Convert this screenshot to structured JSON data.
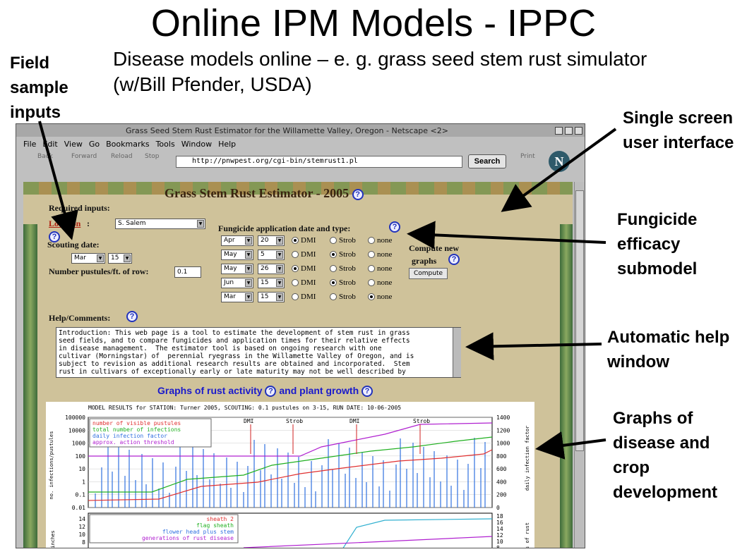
{
  "slide": {
    "title": "Online IPM Models - IPPC",
    "subtitle": "Disease models online – e. g. grass seed stem rust simulator (w/Bill Pfender, USDA)"
  },
  "callouts": {
    "field_sample": "Field sample inputs",
    "single_screen": "Single screen user interface",
    "fungicide": "Fungicide efficacy submodel",
    "help": "Automatic help window",
    "graphs": "Graphs of disease and crop development"
  },
  "browser": {
    "window_title": "Grass Seed Stem Rust Estimator for the Willamette Valley, Oregon - Netscape <2>",
    "menu": [
      "File",
      "Edit",
      "View",
      "Go",
      "Bookmarks",
      "Tools",
      "Window",
      "Help"
    ],
    "toolbar": {
      "back": "Back",
      "forward": "Forward",
      "reload": "Reload",
      "stop": "Stop",
      "url": "http://pnwpest.org/cgi-bin/stemrust1.pl",
      "search": "Search",
      "print": "Print"
    }
  },
  "app": {
    "title": "Grass Stem Rust Estimator - 2005",
    "required_inputs": "Required inputs:",
    "location_label": "Location",
    "location_value": "S. Salem",
    "scouting_label": "Scouting date:",
    "scouting_month": "Mar",
    "scouting_day": "15",
    "pustules_label": "Number pustules/ft. of row:",
    "pustules_value": "0.1",
    "fungicide_header": "Fungicide application date and type:",
    "applications": [
      {
        "month": "Apr",
        "day": "20",
        "type": "DMI"
      },
      {
        "month": "May",
        "day": "5",
        "type": "Strob"
      },
      {
        "month": "May",
        "day": "26",
        "type": "DMI"
      },
      {
        "month": "Jun",
        "day": "15",
        "type": "Strob"
      },
      {
        "month": "Mar",
        "day": "15",
        "type": "none"
      }
    ],
    "type_options": [
      "DMI",
      "Strob",
      "none"
    ],
    "compute_label_1": "Compute new",
    "compute_label_2": "graphs",
    "compute_button": "Compute",
    "help_label": "Help/Comments:",
    "help_text": "Introduction: This web page is a tool to estimate the development of stem rust in grass\nseed fields, and to compare fungicides and application times for their relative effects\nin disease management.  The estimator tool is based on ongoing research with one\ncultivar (Morningstar) of  perennial ryegrass in the Willamette Valley of Oregon, and is\nsubject to revision as additional research results are obtained and incorporated.  Stem\nrust in cultivars of exceptionally early or late maturity may not be well described by",
    "graphs_header_1": "Graphs of rust activity",
    "graphs_header_2": "and plant growth"
  },
  "chart_data": [
    {
      "type": "line",
      "title": "MODEL RESULTS for STATION: Turner 2005, SCOUTING: 0.1 pustules on 3-15, RUN DATE: 10-06-2005",
      "ylabel": "no. infections/pustules",
      "y2label": "daily infection factor",
      "y_ticks": [
        "100000",
        "10000",
        "1000",
        "100",
        "10",
        "1",
        "0.1",
        "0.01"
      ],
      "y2_ticks": [
        "1400",
        "1200",
        "1000",
        "800",
        "600",
        "400",
        "200",
        "0"
      ],
      "legend": [
        "number of visible pustules",
        "total number of infections",
        "daily infection factor",
        "approx. action threshold"
      ],
      "series_colors": {
        "pustules": "#e03030",
        "infections": "#20b020",
        "daily": "#3070e0",
        "threshold": "#b020d0"
      },
      "annotations": [
        "DMI",
        "Strob",
        "DMI",
        "Strob"
      ]
    },
    {
      "type": "line",
      "ylabel": "inches",
      "y2label": "s of rust",
      "y_ticks": [
        "14",
        "12",
        "10",
        "8"
      ],
      "y2_ticks": [
        "18",
        "16",
        "14",
        "12",
        "10",
        "8"
      ],
      "legend": [
        "sheath 2",
        "flag sheath",
        "flower head plus stem",
        "generations of rust disease"
      ],
      "series_colors": {
        "sheath2": "#e03030",
        "flag": "#20b020",
        "flower": "#3070e0",
        "generations": "#b020d0"
      }
    }
  ]
}
